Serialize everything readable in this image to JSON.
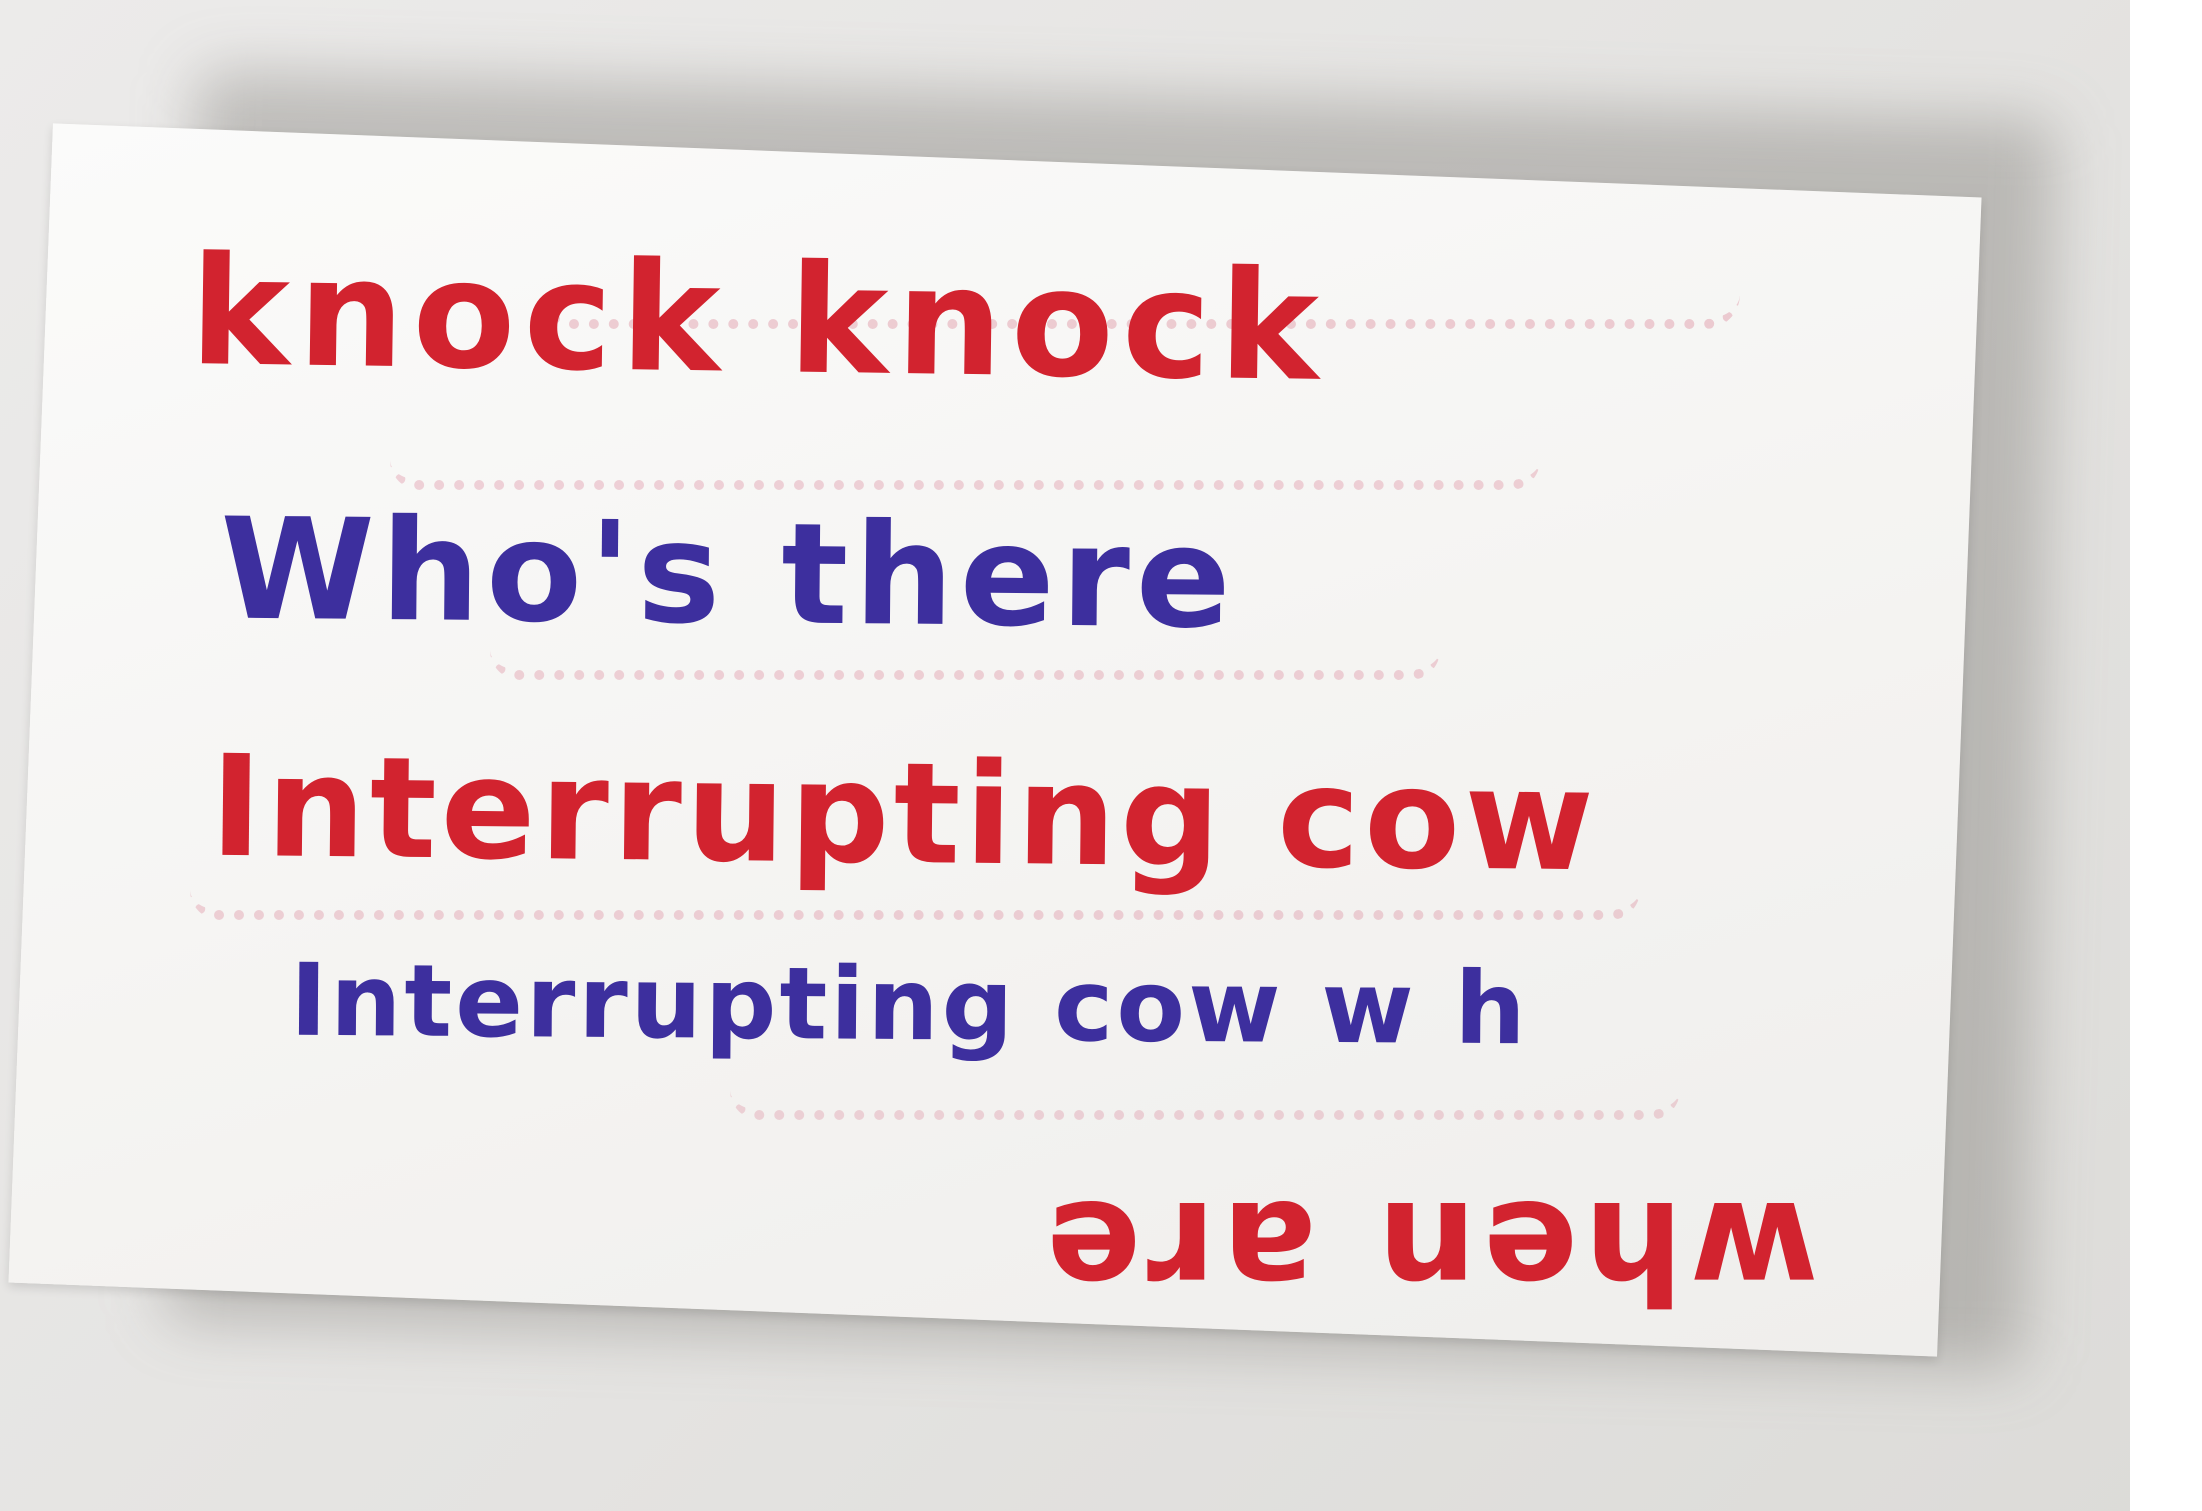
{
  "note": {
    "line1": "knock knock",
    "line2": "Who's there",
    "line3": "Interrupting cow",
    "line4": "Interrupting cow w h",
    "line5": "when are"
  },
  "colors": {
    "red_ink": "#d2232f",
    "blue_ink": "#3d2f9e",
    "paper": "#f7f6f4",
    "background": "#e6e5e3"
  }
}
